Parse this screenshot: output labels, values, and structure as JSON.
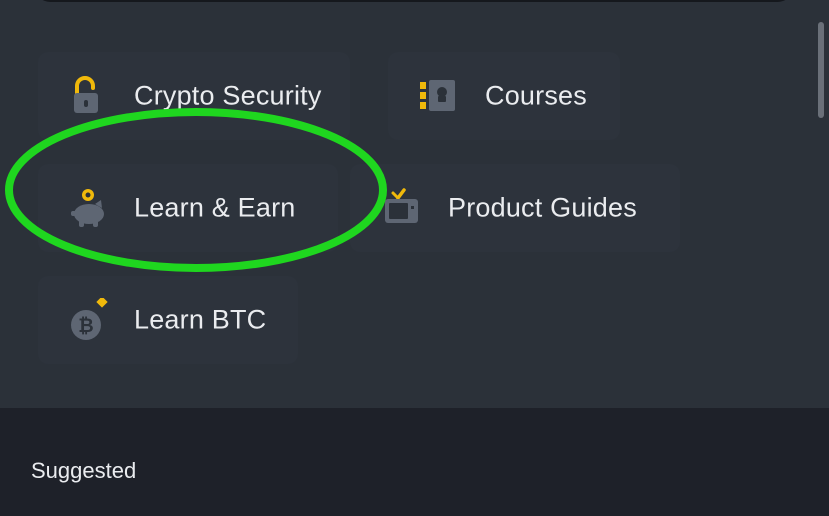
{
  "learn_grid": {
    "items": [
      {
        "id": "crypto-security",
        "label": "Crypto Security",
        "icon": "padlock-icon"
      },
      {
        "id": "courses",
        "label": "Courses",
        "icon": "course-book-icon"
      },
      {
        "id": "learn-earn",
        "label": "Learn & Earn",
        "icon": "piggy-bank-coin-icon"
      },
      {
        "id": "product-guides",
        "label": "Product Guides",
        "icon": "guide-tv-icon"
      },
      {
        "id": "learn-btc",
        "label": "Learn BTC",
        "icon": "bitcoin-icon"
      }
    ]
  },
  "suggested": {
    "title": "Suggested"
  },
  "colors": {
    "accent_yellow": "#f0b90b",
    "highlight_green": "#1fd61f",
    "icon_gray": "#5e6673",
    "panel_bg": "#2b3139",
    "lower_bg": "#1e2129",
    "text": "#eaecef"
  }
}
